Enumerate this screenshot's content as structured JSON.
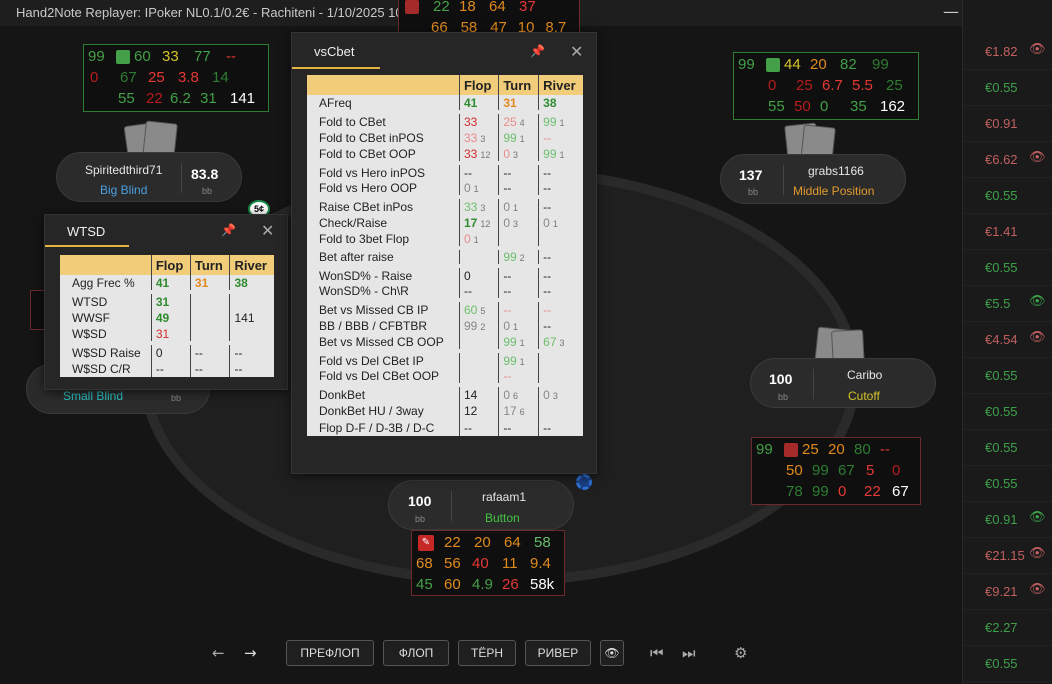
{
  "window": {
    "title": "Hand2Note Replayer: IPoker NL0.1/0.2€ - Rachiteni - 1/10/2025 10",
    "minimize": "—",
    "maximize": "☐",
    "close": "✕"
  },
  "watermark": "om",
  "players": {
    "spirited": {
      "name": "Spiritedthird71",
      "position": "Big Blind",
      "stack": "83.8",
      "unit": "bb"
    },
    "grabs": {
      "name": "grabs1166",
      "position": "Middle Position",
      "stack": "137",
      "unit": "bb"
    },
    "caribo": {
      "name": "Caribo",
      "position": "Cutoff",
      "stack": "100",
      "unit": "bb"
    },
    "rafaam": {
      "name": "rafaam1",
      "position": "Button",
      "stack": "100",
      "unit": "bb"
    },
    "sb": {
      "position": "Small Blind",
      "unit": "bb"
    }
  },
  "huds": {
    "top": {
      "r1": [
        "22",
        "18",
        "64",
        "37"
      ],
      "r2": [
        "66",
        "58",
        "47",
        "10",
        "8.7"
      ]
    },
    "spirited": {
      "r1": [
        "99",
        "60",
        "33",
        "77",
        "--"
      ],
      "r2": [
        "0",
        "67",
        "25",
        "3.8",
        "14"
      ],
      "r3": [
        "55",
        "22",
        "6.2",
        "31",
        "141"
      ]
    },
    "grabs": {
      "r1": [
        "99",
        "44",
        "20",
        "82",
        "99"
      ],
      "r2": [
        "0",
        "25",
        "6.7",
        "5.5",
        "25"
      ],
      "r3": [
        "55",
        "50",
        "0",
        "35",
        "162"
      ]
    },
    "caribo": {
      "r1": [
        "99",
        "25",
        "20",
        "80",
        "--"
      ],
      "r2": [
        "50",
        "99",
        "67",
        "5",
        "0"
      ],
      "r3": [
        "78",
        "99",
        "0",
        "22",
        "67"
      ]
    },
    "rafaam": {
      "r1": [
        "22",
        "20",
        "64",
        "58"
      ],
      "r2": [
        "68",
        "56",
        "40",
        "11",
        "9.4"
      ],
      "r3": [
        "45",
        "60",
        "4.9",
        "26",
        "58k"
      ]
    }
  },
  "vscbet": {
    "title": "vsCbet",
    "pin": "📌",
    "close": "✕",
    "headers": [
      "",
      "Flop",
      "Turn",
      "River"
    ],
    "rows": [
      {
        "label": "AFreq",
        "flop": "41",
        "turn": "31",
        "river": "38"
      },
      {
        "label": "Fold to CBet",
        "flop": "33",
        "turn": "25",
        "turn_sub": "4",
        "river": "99",
        "river_sub": "1"
      },
      {
        "label": "Fold to CBet inPOS",
        "flop": "33",
        "flop_sub": "3",
        "turn": "99",
        "turn_sub": "1",
        "river": "--"
      },
      {
        "label": "Fold to CBet OOP",
        "flop": "33",
        "flop_sub": "12",
        "turn": "0",
        "turn_sub": "3",
        "river": "99",
        "river_sub": "1"
      },
      {
        "label": "Fold vs Hero inPOS",
        "flop": "--",
        "turn": "--",
        "river": "--"
      },
      {
        "label": "Fold vs Hero OOP",
        "flop": "0",
        "flop_sub": "1",
        "turn": "--",
        "river": "--"
      },
      {
        "label": "Raise CBet inPos",
        "flop": "33",
        "flop_sub": "3",
        "turn": "0",
        "turn_sub": "1",
        "river": "--"
      },
      {
        "label": "Check/Raise",
        "flop": "17",
        "flop_sub": "12",
        "turn": "0",
        "turn_sub": "3",
        "river": "0",
        "river_sub": "1"
      },
      {
        "label": "Fold to 3bet Flop",
        "flop": "0",
        "flop_sub": "1",
        "turn": "",
        "river": ""
      },
      {
        "label": "Bet after raise",
        "flop": "",
        "turn": "99",
        "turn_sub": "2",
        "river": "--"
      },
      {
        "label": "WonSD% - Raise",
        "flop": "0",
        "turn": "--",
        "river": "--"
      },
      {
        "label": "WonSD% - Ch\\R",
        "flop": "--",
        "turn": "--",
        "river": "--"
      },
      {
        "label": "Bet vs Missed CB IP",
        "flop": "60",
        "flop_sub": "5",
        "turn": "--",
        "river": "--"
      },
      {
        "label": "BB / BBB / CFBTBR",
        "flop": "99",
        "flop_sub": "2",
        "turn": "0",
        "turn_sub": "1",
        "river": "--"
      },
      {
        "label": "Bet vs Missed CB OOP",
        "flop": "",
        "turn": "99",
        "turn_sub": "1",
        "river": "67",
        "river_sub": "3"
      },
      {
        "label": "Fold vs Del CBet IP",
        "flop": "",
        "turn": "99",
        "turn_sub": "1",
        "river": ""
      },
      {
        "label": "Fold vs Del CBet OOP",
        "flop": "",
        "turn": "--",
        "river": ""
      },
      {
        "label": "DonkBet",
        "flop": "14",
        "turn": "0",
        "turn_sub": "6",
        "river": "0",
        "river_sub": "3"
      },
      {
        "label": "DonkBet HU / 3way",
        "flop": "12",
        "turn": "17",
        "turn_sub": "6",
        "river": ""
      },
      {
        "label": "Flop D-F / D-3B / D-C",
        "flop": "--",
        "turn": "--",
        "river": "--"
      }
    ]
  },
  "wtsd": {
    "title": "WTSD",
    "pin": "📌",
    "close": "✕",
    "headers": [
      "",
      "Flop",
      "Turn",
      "River"
    ],
    "rows": [
      {
        "label": "Agg Frec %",
        "flop": "41",
        "turn": "31",
        "river": "38"
      },
      {
        "label": "WTSD",
        "flop": "31",
        "turn": "",
        "river": ""
      },
      {
        "label": "WWSF",
        "flop": "49",
        "turn": "",
        "river": "141"
      },
      {
        "label": "W$SD",
        "flop": "31",
        "turn": "",
        "river": ""
      },
      {
        "label": "W$SD Raise",
        "flop": "0",
        "turn": "--",
        "river": "--"
      },
      {
        "label": "W$SD C/R",
        "flop": "--",
        "turn": "--",
        "river": "--"
      }
    ]
  },
  "sidebar": [
    {
      "amount": "€1.82",
      "eye": "👁",
      "color": "#c06060",
      "eye_color": "#c06060"
    },
    {
      "amount": "€0.55",
      "eye": "",
      "color": "#3fa04a"
    },
    {
      "amount": "€0.91",
      "eye": "",
      "color": "#c06060"
    },
    {
      "amount": "€6.62",
      "eye": "👁",
      "color": "#c06060",
      "eye_color": "#c06060"
    },
    {
      "amount": "€0.55",
      "eye": "",
      "color": "#3fa04a"
    },
    {
      "amount": "€1.41",
      "eye": "",
      "color": "#c06060"
    },
    {
      "amount": "€0.55",
      "eye": "",
      "color": "#3fa04a"
    },
    {
      "amount": "€5.5",
      "eye": "👁",
      "color": "#3fa04a",
      "eye_color": "#3fa04a"
    },
    {
      "amount": "€4.54",
      "eye": "👁",
      "color": "#c06060",
      "eye_color": "#c06060"
    },
    {
      "amount": "€0.55",
      "eye": "",
      "color": "#3fa04a"
    },
    {
      "amount": "€0.55",
      "eye": "",
      "color": "#3fa04a"
    },
    {
      "amount": "€0.55",
      "eye": "",
      "color": "#3fa04a"
    },
    {
      "amount": "€0.55",
      "eye": "",
      "color": "#3fa04a"
    },
    {
      "amount": "€0.91",
      "eye": "👁",
      "color": "#3fa04a",
      "eye_color": "#3fa04a"
    },
    {
      "amount": "€21.15",
      "eye": "👁",
      "color": "#c06060",
      "eye_color": "#c06060"
    },
    {
      "amount": "€9.21",
      "eye": "👁",
      "color": "#c06060",
      "eye_color": "#c06060"
    },
    {
      "amount": "€2.27",
      "eye": "",
      "color": "#3fa04a"
    },
    {
      "amount": "€0.55",
      "eye": "",
      "color": "#3fa04a"
    }
  ],
  "controls": {
    "back": "←",
    "forward": "→",
    "preflop": "ПРЕФЛОП",
    "flop": "ФЛОП",
    "turn": "ТЁРН",
    "river": "РИВЕР",
    "eye": "👁",
    "first": "⏮",
    "last": "⏭",
    "settings": "⚙"
  }
}
